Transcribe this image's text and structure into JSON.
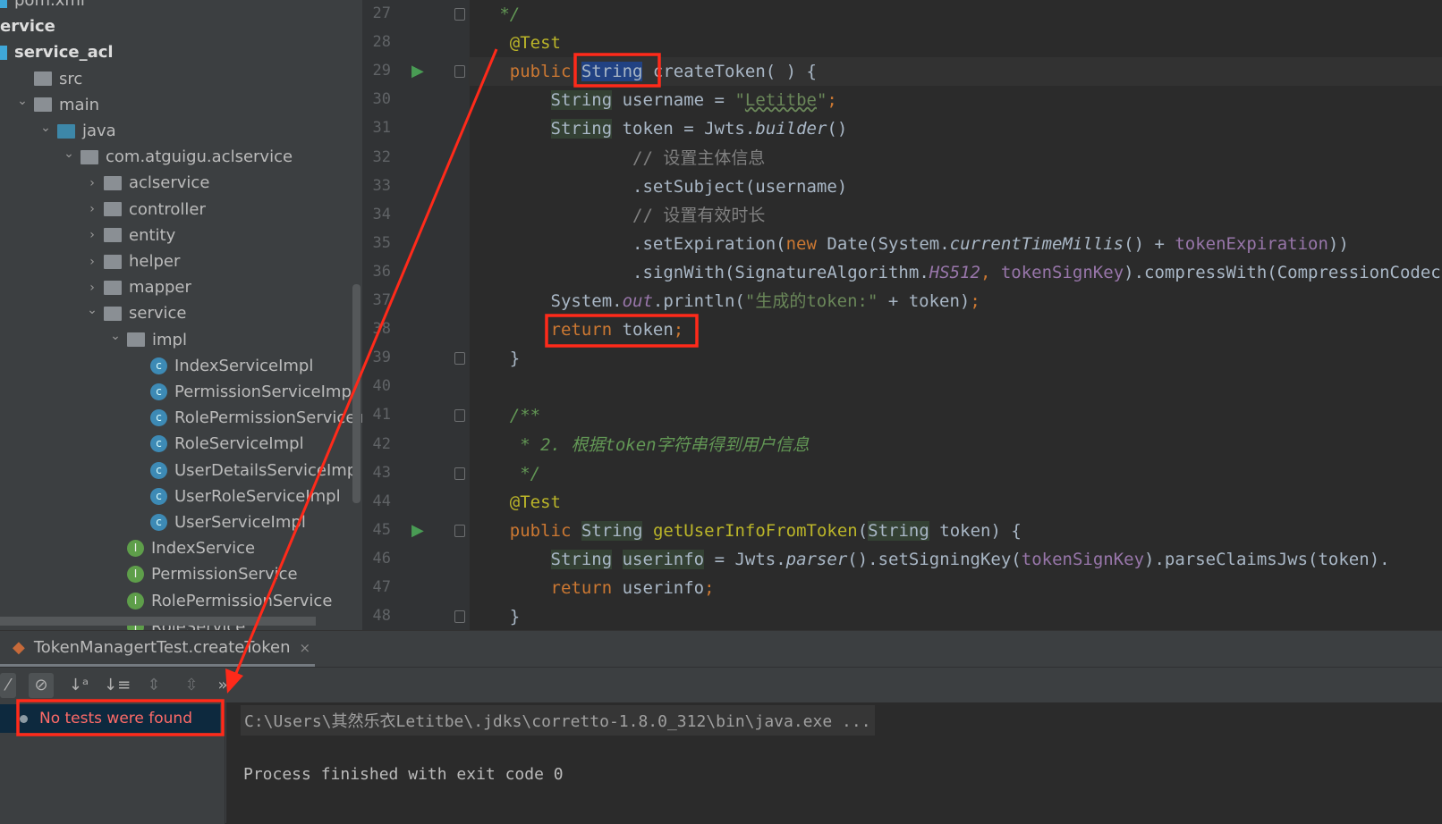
{
  "project_tree": [
    {
      "label": "pom.xml",
      "indent": 0,
      "icon": "xml-file-icon",
      "type": "file"
    },
    {
      "label": "ervice",
      "indent": 0,
      "icon": "",
      "type": "bold"
    },
    {
      "label": "service_acl",
      "indent": 0,
      "icon": "module-icon",
      "type": "bold"
    },
    {
      "label": "src",
      "indent": 1,
      "icon": "folder-icon",
      "type": "folder"
    },
    {
      "label": "main",
      "indent": 1,
      "icon": "folder-icon",
      "type": "folder",
      "expanded": true
    },
    {
      "label": "java",
      "indent": 2,
      "icon": "source-folder-icon",
      "type": "src",
      "expanded": true
    },
    {
      "label": "com.atguigu.aclservice",
      "indent": 3,
      "icon": "package-icon",
      "type": "folder",
      "expanded": true
    },
    {
      "label": "aclservice",
      "indent": 4,
      "icon": "package-icon",
      "type": "folder",
      "expanded": false
    },
    {
      "label": "controller",
      "indent": 4,
      "icon": "package-icon",
      "type": "folder",
      "expanded": false
    },
    {
      "label": "entity",
      "indent": 4,
      "icon": "package-icon",
      "type": "folder",
      "expanded": false
    },
    {
      "label": "helper",
      "indent": 4,
      "icon": "package-icon",
      "type": "folder",
      "expanded": false
    },
    {
      "label": "mapper",
      "indent": 4,
      "icon": "package-icon",
      "type": "folder",
      "expanded": false
    },
    {
      "label": "service",
      "indent": 4,
      "icon": "package-icon",
      "type": "folder",
      "expanded": true
    },
    {
      "label": "impl",
      "indent": 5,
      "icon": "package-icon",
      "type": "folder",
      "expanded": true
    },
    {
      "label": "IndexServiceImpl",
      "indent": 6,
      "icon": "class-icon",
      "type": "class"
    },
    {
      "label": "PermissionServiceImpl",
      "indent": 6,
      "icon": "class-icon",
      "type": "class"
    },
    {
      "label": "RolePermissionServiceImpl",
      "indent": 6,
      "icon": "class-icon",
      "type": "class"
    },
    {
      "label": "RoleServiceImpl",
      "indent": 6,
      "icon": "class-icon",
      "type": "class"
    },
    {
      "label": "UserDetailsServiceImpl",
      "indent": 6,
      "icon": "class-icon",
      "type": "class"
    },
    {
      "label": "UserRoleServiceImpl",
      "indent": 6,
      "icon": "class-icon",
      "type": "class"
    },
    {
      "label": "UserServiceImpl",
      "indent": 6,
      "icon": "class-icon",
      "type": "class"
    },
    {
      "label": "IndexService",
      "indent": 5,
      "icon": "interface-icon",
      "type": "intf"
    },
    {
      "label": "PermissionService",
      "indent": 5,
      "icon": "interface-icon",
      "type": "intf"
    },
    {
      "label": "RolePermissionService",
      "indent": 5,
      "icon": "interface-icon",
      "type": "intf"
    },
    {
      "label": "RoleService",
      "indent": 5,
      "icon": "interface-icon",
      "type": "intf"
    }
  ],
  "editor": {
    "lines": [
      {
        "n": "27",
        "t": [
          [
            "   */",
            "jd"
          ]
        ]
      },
      {
        "n": "28",
        "t": [
          [
            "    ",
            ""
          ],
          [
            "@Test",
            "ann"
          ]
        ]
      },
      {
        "n": "29",
        "run": true,
        "t": [
          [
            "    ",
            ""
          ],
          [
            "public ",
            "kw"
          ],
          [
            "String",
            "sel"
          ],
          [
            " createToken( ) {",
            ""
          ]
        ]
      },
      {
        "n": "30",
        "t": [
          [
            "        ",
            ""
          ],
          [
            "String",
            "hl"
          ],
          [
            " username = ",
            ""
          ],
          [
            "\"",
            "str"
          ],
          [
            "Letitbe",
            "str wavy"
          ],
          [
            "\"",
            "str"
          ],
          [
            ";",
            "kw"
          ]
        ]
      },
      {
        "n": "31",
        "t": [
          [
            "        ",
            ""
          ],
          [
            "String",
            "hl"
          ],
          [
            " token = Jwts.",
            ""
          ],
          [
            "builder",
            "st"
          ],
          [
            "()",
            ""
          ]
        ]
      },
      {
        "n": "32",
        "t": [
          [
            "                ",
            ""
          ],
          [
            "// 设置主体信息",
            "cm"
          ]
        ]
      },
      {
        "n": "33",
        "t": [
          [
            "                .setSubject(username)",
            ""
          ]
        ]
      },
      {
        "n": "34",
        "t": [
          [
            "                ",
            ""
          ],
          [
            "// 设置有效时长",
            "cm"
          ]
        ]
      },
      {
        "n": "35",
        "t": [
          [
            "                .setExpiration(",
            ""
          ],
          [
            "new ",
            "kw"
          ],
          [
            "Date(System.",
            ""
          ],
          [
            "currentTimeMillis",
            "st"
          ],
          [
            "() + ",
            ""
          ],
          [
            "tokenExpiration",
            "fld"
          ],
          [
            "))",
            ""
          ]
        ]
      },
      {
        "n": "36",
        "t": [
          [
            "                .signWith(SignatureAlgorithm.",
            ""
          ],
          [
            "HS512",
            "stf"
          ],
          [
            ", ",
            "kw"
          ],
          [
            "tokenSignKey",
            "fld"
          ],
          [
            ").compressWith(CompressionCodecs.",
            ""
          ]
        ]
      },
      {
        "n": "37",
        "t": [
          [
            "        System.",
            ""
          ],
          [
            "out",
            "stf"
          ],
          [
            ".println(",
            ""
          ],
          [
            "\"生成的token:\"",
            "str"
          ],
          [
            " + token)",
            ""
          ],
          [
            ";",
            "kw"
          ]
        ]
      },
      {
        "n": "38",
        "t": [
          [
            "        ",
            ""
          ],
          [
            "return ",
            "kw"
          ],
          [
            "token",
            ""
          ],
          [
            ";",
            "kw"
          ]
        ]
      },
      {
        "n": "39",
        "t": [
          [
            "    }",
            ""
          ]
        ]
      },
      {
        "n": "40",
        "t": []
      },
      {
        "n": "41",
        "t": [
          [
            "    ",
            ""
          ],
          [
            "/**",
            "jd"
          ]
        ]
      },
      {
        "n": "42",
        "t": [
          [
            "     ",
            ""
          ],
          [
            "* 2. 根据token字符串得到用户信息",
            "jd"
          ]
        ]
      },
      {
        "n": "43",
        "t": [
          [
            "     ",
            ""
          ],
          [
            "*/",
            "jd"
          ]
        ]
      },
      {
        "n": "44",
        "t": [
          [
            "    ",
            ""
          ],
          [
            "@Test",
            "ann"
          ]
        ]
      },
      {
        "n": "45",
        "run": true,
        "t": [
          [
            "    ",
            ""
          ],
          [
            "public ",
            "kw"
          ],
          [
            "String",
            "hl"
          ],
          [
            " ",
            ""
          ],
          [
            "getUserInfoFromToken",
            "ann"
          ],
          [
            "(",
            ""
          ],
          [
            "String",
            "hl"
          ],
          [
            " token) {",
            ""
          ]
        ]
      },
      {
        "n": "46",
        "t": [
          [
            "        ",
            ""
          ],
          [
            "String",
            "hl"
          ],
          [
            " ",
            ""
          ],
          [
            "userinfo",
            "hl"
          ],
          [
            " = Jwts.",
            ""
          ],
          [
            "parser",
            "st"
          ],
          [
            "().setSigningKey(",
            ""
          ],
          [
            "tokenSignKey",
            "fld"
          ],
          [
            ").parseClaimsJws(token).",
            ""
          ]
        ]
      },
      {
        "n": "47",
        "t": [
          [
            "        ",
            ""
          ],
          [
            "return ",
            "kw"
          ],
          [
            "userinfo",
            ""
          ],
          [
            ";",
            "kw"
          ]
        ]
      },
      {
        "n": "48",
        "t": [
          [
            "    }",
            ""
          ]
        ]
      }
    ]
  },
  "run_panel": {
    "tab_label": "TokenManagertTest.createToken",
    "close": "×",
    "more": "»",
    "test_status": "No tests were found",
    "console_command": "C:\\Users\\其然乐衣Letitbe\\.jdks\\corretto-1.8.0_312\\bin\\java.exe ...",
    "console_exit": "Process finished with exit code 0"
  },
  "colors": {
    "annotation_red": "#ff2a1a",
    "keyword": "#cc7832",
    "string": "#6a8759",
    "error_text": "#ff6b68"
  }
}
